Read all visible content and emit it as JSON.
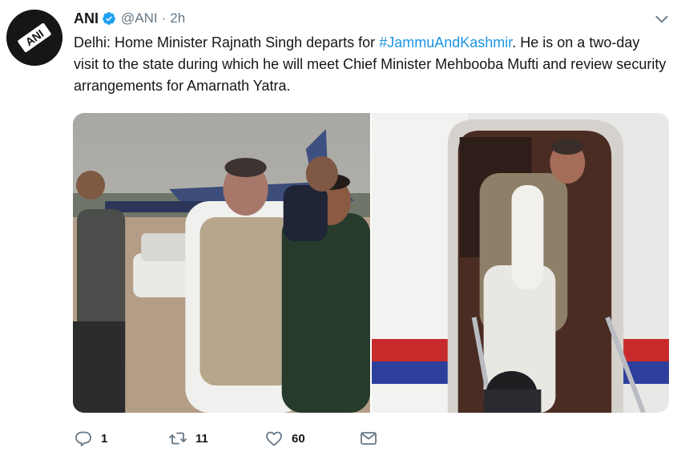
{
  "tweet": {
    "author_name": "ANI",
    "handle": "@ANI",
    "separator": "·",
    "time": "2h",
    "text_before": "Delhi: Home Minister Rajnath Singh departs for ",
    "hashtag": "#JammuAndKashmir",
    "text_after": ". He is on a two-day visit to the state during which he will meet Chief Minister Mehbooba Mufti and review security arrangements for Amarnath Yatra.",
    "avatar_text": "ANI"
  },
  "actions": {
    "reply_count": "1",
    "retweet_count": "11",
    "like_count": "60"
  },
  "icons": {
    "verified": "verified-badge-icon",
    "caret": "chevron-down-icon",
    "reply": "reply-icon",
    "retweet": "retweet-icon",
    "like": "heart-icon",
    "message": "direct-message-icon"
  },
  "colors": {
    "hashtag": "#1b95e0",
    "verified": "#1da1f2",
    "muted": "#657786",
    "text": "#14171a"
  }
}
